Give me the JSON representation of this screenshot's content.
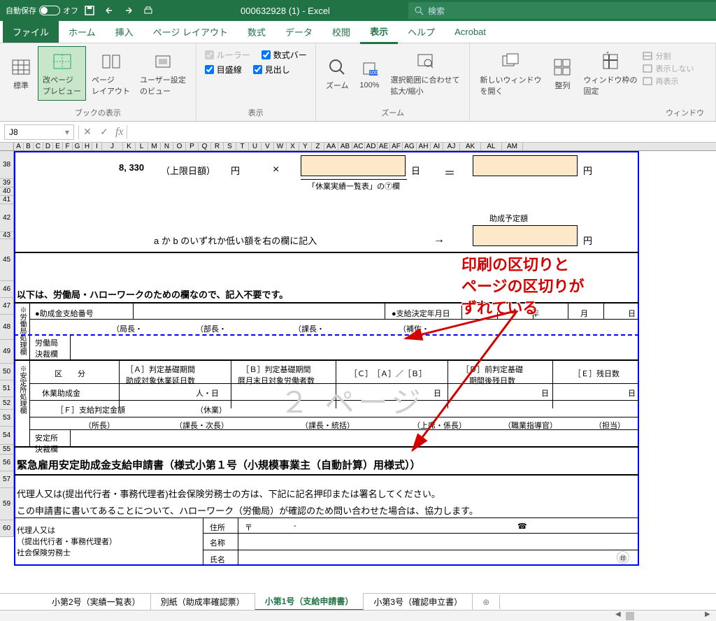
{
  "titlebar": {
    "auto_save": "自動保存",
    "auto_state": "オフ",
    "title": "000632928 (1) - Excel",
    "search_placeholder": "検索"
  },
  "tabs": {
    "file": "ファイル",
    "home": "ホーム",
    "insert": "挿入",
    "layout": "ページ レイアウト",
    "formula": "数式",
    "data": "データ",
    "review": "校閲",
    "view": "表示",
    "help": "ヘルプ",
    "acrobat": "Acrobat"
  },
  "ribbon": {
    "group_view": "ブックの表示",
    "group_show": "表示",
    "group_zoom": "ズーム",
    "group_window": "ウィンドウ",
    "btn_normal": "標準",
    "btn_pagebreak": "改ページ\nプレビュー",
    "btn_pagelayout": "ページ\nレイアウト",
    "btn_custom": "ユーザー設定\nのビュー",
    "chk_ruler": "ルーラー",
    "chk_formula": "数式バー",
    "chk_grid": "目盛線",
    "chk_headings": "見出し",
    "btn_zoom": "ズーム",
    "btn_100": "100%",
    "btn_zoomsel": "選択範囲に合わせて\n拡大/縮小",
    "btn_newwin": "新しいウィンドウ\nを開く",
    "btn_arrange": "整列",
    "btn_freeze": "ウィンドウ枠の\n固定",
    "opt_split": "分割",
    "opt_hide": "表示しない",
    "opt_unhide": "再表示"
  },
  "formula": {
    "namebox": "J8"
  },
  "cols": [
    "A",
    "B",
    "C",
    "D",
    "E",
    "F",
    "G",
    "H",
    "I",
    "J",
    "K",
    "L",
    "M",
    "N",
    "O",
    "P",
    "Q",
    "R",
    "S",
    "T",
    "U",
    "V",
    "W",
    "X",
    "Y",
    "Z",
    "AA",
    "AB",
    "AC",
    "AD",
    "AE",
    "AF",
    "AG",
    "AH",
    "AI",
    "AJ",
    "AK",
    "AL",
    "AM"
  ],
  "rows": [
    "38",
    "39",
    "40",
    "41",
    "42",
    "43",
    "45",
    "46",
    "47",
    "48",
    "49",
    "50",
    "51",
    "52",
    "53",
    "54",
    "55",
    "56",
    "57",
    "59",
    "60"
  ],
  "doc": {
    "amount_8330": "8, 330",
    "upper_limit": "（上限日額）",
    "yen": "円",
    "times": "×",
    "day": "日",
    "equals": "＝",
    "note7": "「休業実績一覧表」の⑦欄",
    "jyosei_yotei": "助成予定額",
    "a_or_b": "a か b のいずれか低い額を右の欄に記入",
    "arrow": "→",
    "below_note": "以下は、労働局・ハローワークのための欄なので、記入不要です。",
    "vert_roudou": "※労働局処理欄",
    "vert_antei": "※安定所処理欄",
    "bullet_joseikin": "●助成金支給番号",
    "bullet_kettei": "●支給決定年月日",
    "nen": "年",
    "tsuki": "月",
    "hi": "日",
    "roudou_kessai": "労働局\n決裁欄",
    "kyoku": "（局長・",
    "bucho": "（部長・",
    "kacho": "（課長・",
    "hosa": "（補佐・",
    "kubun": "区　　分",
    "col_a": "［Ａ］判定基礎期間\n助成対象休業延日数",
    "col_b": "［Ｂ］判定基礎期間\n暦月末日対象労働者数",
    "col_c": "［Ｃ］　［Ａ］／［Ｂ］",
    "col_d": "［Ｄ］前判定基礎\n期間後残日数",
    "col_e": "［Ｅ］残日数",
    "kyugyo_josei": "休業助成金",
    "hito_hi": "人・日",
    "label_f": "［Ｆ］支給判定金額",
    "kyugyo": "（休業）",
    "shocho": "（所長）",
    "kacho_jicho": "（課長・次長）",
    "kacho_toukatsu": "（課長・統括）",
    "joseki": "（上席・係長）",
    "shokugyo": "（職業指導官）",
    "tanto": "（担当）",
    "antei_kessai": "安定所\n決裁欄",
    "title_form": "緊急雇用安定助成金支給申請書（様式小第１号（小規模事業主（自動計算）用様式））",
    "dairi_line1": "代理人又は(提出代行者・事務代理者)社会保険労務士の方は、下記に記名押印または署名してください。",
    "dairi_line2": "この申請書に書いてあることについて、ハローワーク（労働局）が確認のため問い合わせた場合は、協力します。",
    "dairi_side": "代理人又は\n（提出代行者・事務代理者）\n社会保険労務士",
    "addr": "住所",
    "tel_t": "〒",
    "dash": "-",
    "tel": "☎",
    "meisho": "名称",
    "shimei": "氏名",
    "page2": "２ ページ"
  },
  "annotation": {
    "l1": "印刷の区切りと",
    "l2": "ページの区切りが",
    "l3": "ずれている"
  },
  "sheets": {
    "s2": "小第2号（実績一覧表）",
    "sB": "別紙（助成率確認票）",
    "s1": "小第1号（支給申請書）",
    "s3": "小第3号（確認申立書）"
  }
}
